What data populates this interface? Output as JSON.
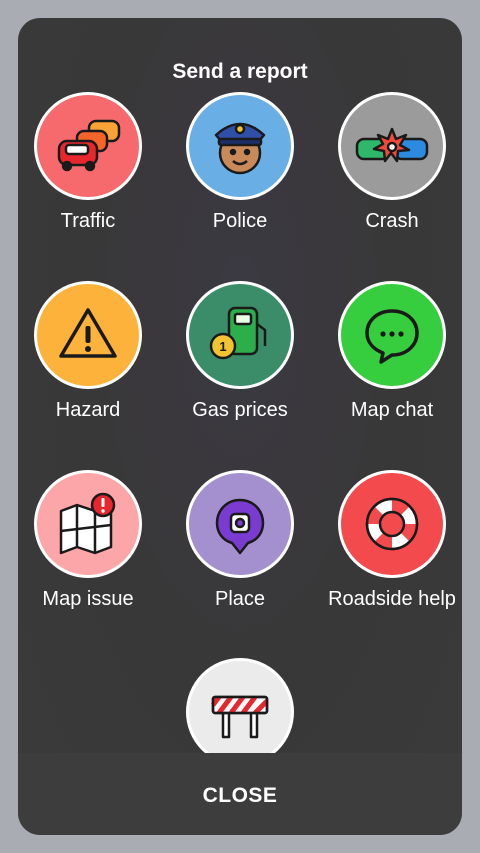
{
  "title": "Send a report",
  "items": [
    {
      "label": "Traffic",
      "icon": "traffic-cars-icon",
      "color": "#f66a6d"
    },
    {
      "label": "Police",
      "icon": "police-officer-icon",
      "color": "#6aaee6"
    },
    {
      "label": "Crash",
      "icon": "car-crash-icon",
      "color": "#9b9b9b"
    },
    {
      "label": "Hazard",
      "icon": "warning-triangle-icon",
      "color": "#fdb33b"
    },
    {
      "label": "Gas prices",
      "icon": "gas-pump-icon",
      "color": "#3b8d6a"
    },
    {
      "label": "Map chat",
      "icon": "chat-bubble-icon",
      "color": "#36cd3f"
    },
    {
      "label": "Map issue",
      "icon": "map-alert-icon",
      "color": "#fca6aa"
    },
    {
      "label": "Place",
      "icon": "place-pin-icon",
      "color": "#a490ce"
    },
    {
      "label": "Roadside help",
      "icon": "lifebuoy-icon",
      "color": "#f34a4e"
    },
    {
      "label": "",
      "icon": "road-barrier-icon",
      "color": "#ebebeb"
    }
  ],
  "close_label": "CLOSE"
}
